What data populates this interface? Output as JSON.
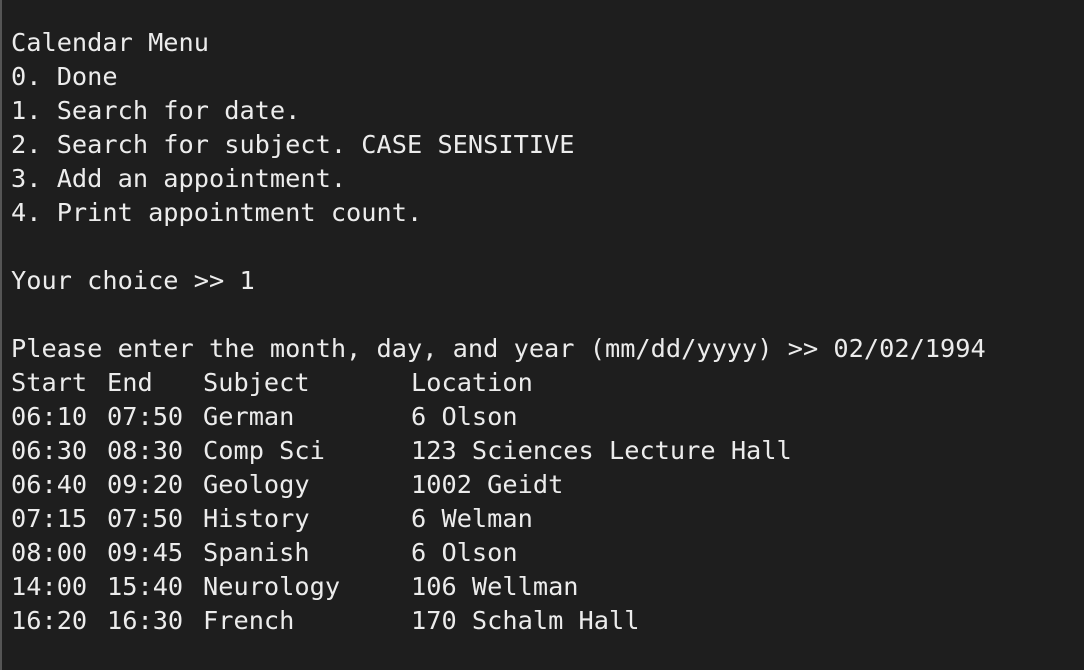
{
  "terminal": {
    "menu_title": "Calendar Menu",
    "menu_items": [
      "0. Done",
      "1. Search for date.",
      "2. Search for subject. CASE SENSITIVE",
      "3. Add an appointment.",
      "4. Print appointment count."
    ],
    "choice_prompt": "Your choice >> ",
    "choice_value": "1",
    "date_prompt": "Please enter the month, day, and year (mm/dd/yyyy) >> ",
    "date_value": "02/02/1994",
    "table": {
      "headers": [
        "Start",
        "End",
        "Subject",
        "Location"
      ],
      "rows": [
        [
          "06:10",
          "07:50",
          "German",
          "6 Olson"
        ],
        [
          "06:30",
          "08:30",
          "Comp Sci",
          "123 Sciences Lecture Hall"
        ],
        [
          "06:40",
          "09:20",
          "Geology",
          "1002 Geidt"
        ],
        [
          "07:15",
          "07:50",
          "History",
          "6 Welman"
        ],
        [
          "08:00",
          "09:45",
          "Spanish",
          "6 Olson"
        ],
        [
          "14:00",
          "15:40",
          "Neurology",
          "106 Wellman"
        ],
        [
          "16:20",
          "16:30",
          "French",
          "170 Schalm Hall"
        ]
      ]
    }
  },
  "colors": {
    "background": "#1e1e1e",
    "text": "#ececec",
    "border": "#555555"
  }
}
